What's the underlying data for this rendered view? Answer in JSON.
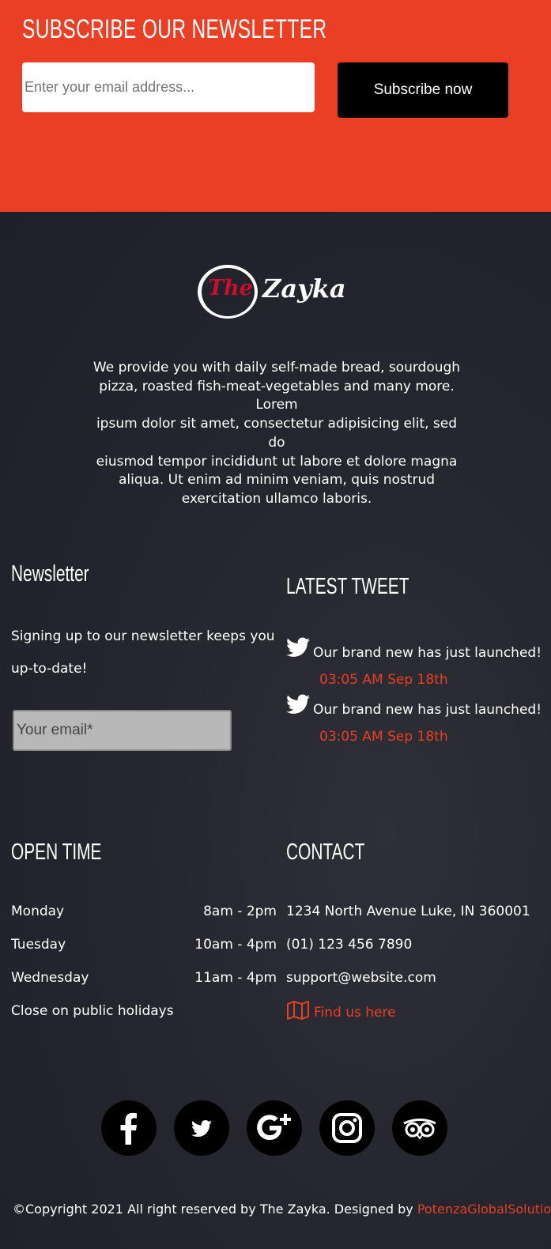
{
  "subscribe": {
    "title": "SUBSCRIBE OUR NEWSLETTER",
    "email_placeholder": "Enter your email address...",
    "button_label": "Subscribe now"
  },
  "logo": {
    "the": "The",
    "zayka": "Zayka"
  },
  "about": {
    "lines": [
      "We provide you with daily self-made bread, sourdough",
      "pizza, roasted fish-meat-vegetables and many more.",
      "Lorem",
      "ipsum dolor sit amet, consectetur adipisicing elit, sed do",
      "eiusmod tempor incididunt ut labore et dolore magna",
      "aliqua. Ut enim ad minim veniam, quis nostrud",
      "exercitation ullamco laboris."
    ]
  },
  "newsletter": {
    "title": "Newsletter",
    "text": "Signing up to our newsletter keeps you up-to-date!",
    "email_placeholder": "Your email*"
  },
  "tweets": {
    "title": "LATEST TWEET",
    "items": [
      {
        "text": "Our brand new has just launched!",
        "time": "03:05 AM Sep 18th",
        "icon": "twitter-icon"
      },
      {
        "text": "Our brand new has just launched!",
        "time": "03:05 AM Sep 18th",
        "icon": "twitter-icon"
      }
    ]
  },
  "open_time": {
    "title": "OPEN TIME",
    "rows": [
      {
        "day": "Monday",
        "time": "8am - 2pm"
      },
      {
        "day": "Tuesday",
        "time": "10am - 4pm"
      },
      {
        "day": "Wednesday",
        "time": "11am - 4pm"
      }
    ],
    "note": "Close on public holidays"
  },
  "contact": {
    "title": "CONTACT",
    "address": "1234 North Avenue Luke, IN 360001",
    "phone": "(01) 123 456 7890",
    "email": "support@website.com",
    "map_label": "Find us here",
    "map_icon": "map-icon"
  },
  "social": [
    "facebook-icon",
    "twitter-icon",
    "google-plus-icon",
    "instagram-icon",
    "tripadvisor-icon"
  ],
  "copyright": {
    "text": "©Copyright 2021 All right reserved by The Zayka. Designed by ",
    "designer": "PotenzaGlobalSolutions"
  },
  "colors": {
    "accent": "#ea3f24",
    "dark": "#24252d",
    "brand_red": "#c8102e"
  }
}
